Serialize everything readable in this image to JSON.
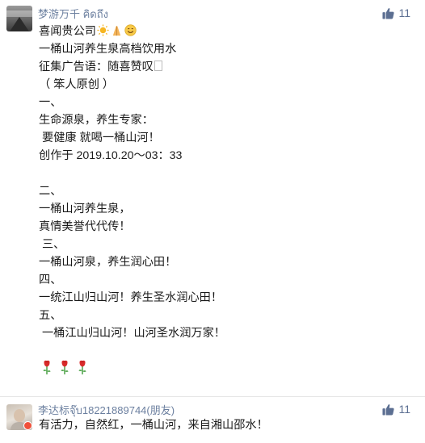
{
  "comments": [
    {
      "author": "梦游万千 คิดถึง",
      "likes": "11",
      "lines": {
        "l1": "喜闻贵公司",
        "l2": "一桶山河养生泉高档饮用水",
        "l3": "征集广告语：随喜赞叹",
        "l4": "（ 笨人原创 ）",
        "l5": "一、",
        "l6": "生命源泉，养生专家：",
        "l7": " 要健康 就喝一桶山河！",
        "l8": "创作于 2019.10.20～03：33",
        "l9": "",
        "l10": "二、",
        "l11": "一桶山河养生泉，",
        "l12": "真情美誉代代传！",
        "l13": " 三、",
        "l14": "一桶山河泉，养生润心田！",
        "l15": "四、",
        "l16": "一统江山归山河！养生圣水润心田！",
        "l17": "五、",
        "l18": " 一桶江山归山河！山河圣水润万家！"
      },
      "emojis": [
        "sun-emoji",
        "namaste-emoji",
        "smile-emoji"
      ],
      "roses": [
        "rose-emoji",
        "rose-emoji",
        "rose-emoji"
      ]
    },
    {
      "author": "李达标จุ๊บ18221889744(朋友)",
      "likes": "11",
      "text": "有活力，自然红，一桶山河，来自湘山邵水！"
    }
  ],
  "colors": {
    "author_name": "#6b7f9f",
    "like_count": "#5c6f92",
    "online_dot": "#f0503a"
  }
}
